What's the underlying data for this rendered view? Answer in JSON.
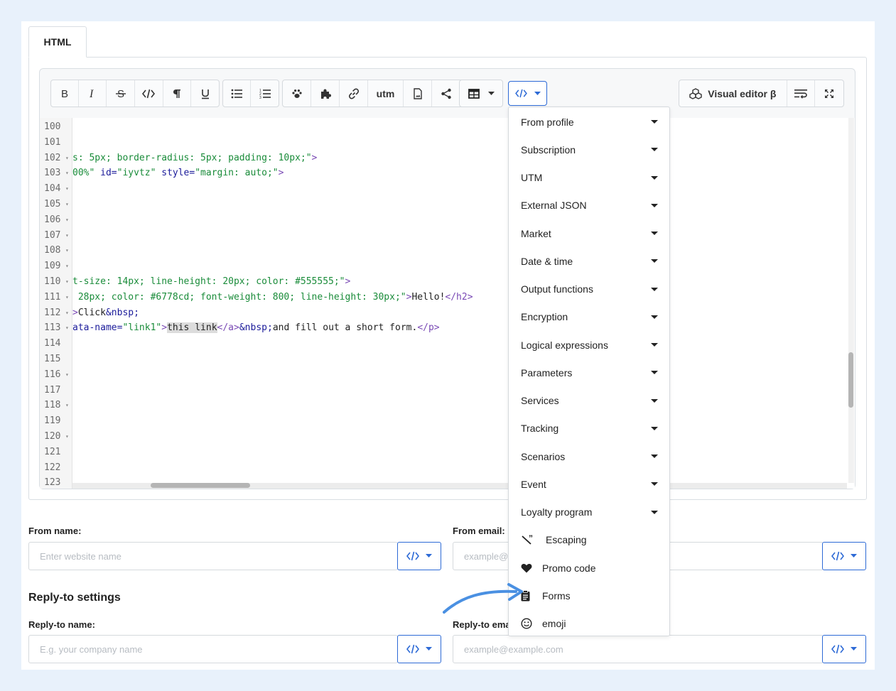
{
  "tabs": [
    {
      "label": "HTML"
    }
  ],
  "toolbar": {
    "utm_label": "utm",
    "visual_editor_label": "Visual editor β"
  },
  "code_lines": [
    {
      "n": "100",
      "fold": false,
      "parts": []
    },
    {
      "n": "101",
      "fold": false,
      "parts": []
    },
    {
      "n": "102",
      "fold": true,
      "parts": [
        [
          "str",
          "s: 5px; border-radius: 5px; padding: 10px;\""
        ],
        [
          "tag",
          ">"
        ]
      ]
    },
    {
      "n": "103",
      "fold": true,
      "parts": [
        [
          "str",
          "00%\""
        ],
        [
          "plain",
          " "
        ],
        [
          "attr",
          "id="
        ],
        [
          "str",
          "\"iyvtz\""
        ],
        [
          "plain",
          " "
        ],
        [
          "attr",
          "style="
        ],
        [
          "str",
          "\"margin: auto;\""
        ],
        [
          "tag",
          ">"
        ]
      ]
    },
    {
      "n": "104",
      "fold": true,
      "parts": []
    },
    {
      "n": "105",
      "fold": true,
      "parts": []
    },
    {
      "n": "106",
      "fold": true,
      "parts": []
    },
    {
      "n": "107",
      "fold": true,
      "parts": []
    },
    {
      "n": "108",
      "fold": true,
      "parts": []
    },
    {
      "n": "109",
      "fold": true,
      "parts": []
    },
    {
      "n": "110",
      "fold": true,
      "parts": [
        [
          "str",
          "t-size: 14px; line-height: 20px; color: #555555;\""
        ],
        [
          "tag",
          ">"
        ]
      ]
    },
    {
      "n": "111",
      "fold": true,
      "parts": [
        [
          "str",
          " 28px; color: #6778cd; font-weight: 800; line-height: 30px;\""
        ],
        [
          "tag",
          ">"
        ],
        [
          "plain",
          "Hello!"
        ],
        [
          "tag",
          "</h2>"
        ]
      ]
    },
    {
      "n": "112",
      "fold": true,
      "parts": [
        [
          "tag",
          ">"
        ],
        [
          "plain",
          "Click"
        ],
        [
          "ent",
          "&nbsp;"
        ]
      ]
    },
    {
      "n": "113",
      "fold": true,
      "parts": [
        [
          "attr",
          "ata-name="
        ],
        [
          "str",
          "\"link1\""
        ],
        [
          "tag",
          ">"
        ],
        [
          "sel",
          "this link"
        ],
        [
          "tag",
          "</a>"
        ],
        [
          "ent",
          "&nbsp;"
        ],
        [
          "plain",
          "and fill out a short form."
        ],
        [
          "tag",
          "</p>"
        ]
      ]
    },
    {
      "n": "114",
      "fold": false,
      "parts": []
    },
    {
      "n": "115",
      "fold": false,
      "parts": []
    },
    {
      "n": "116",
      "fold": true,
      "parts": []
    },
    {
      "n": "117",
      "fold": false,
      "parts": []
    },
    {
      "n": "118",
      "fold": true,
      "parts": []
    },
    {
      "n": "119",
      "fold": false,
      "parts": []
    },
    {
      "n": "120",
      "fold": true,
      "parts": []
    },
    {
      "n": "121",
      "fold": false,
      "parts": []
    },
    {
      "n": "122",
      "fold": false,
      "parts": []
    },
    {
      "n": "123",
      "fold": false,
      "parts": []
    }
  ],
  "dropdown": {
    "submenus": [
      "From profile",
      "Subscription",
      "UTM",
      "External JSON",
      "Market",
      "Date & time",
      "Output functions",
      "Encryption",
      "Logical expressions",
      "Parameters",
      "Services",
      "Tracking",
      "Scenarios",
      "Event",
      "Loyalty program"
    ],
    "actions": [
      {
        "label": "Escaping",
        "icon": "escaping-icon"
      },
      {
        "label": "Promo code",
        "icon": "heart-icon"
      },
      {
        "label": "Forms",
        "icon": "clipboard-icon"
      },
      {
        "label": "emoji",
        "icon": "smiley-icon"
      }
    ]
  },
  "form": {
    "from_name_label": "From name:",
    "from_name_placeholder": "Enter website name",
    "from_email_label": "From email:",
    "from_email_placeholder": "example@",
    "reply_section_title": "Reply-to settings",
    "reply_name_label": "Reply-to name:",
    "reply_name_placeholder": "E.g. your company name",
    "reply_email_label": "Reply-to ema",
    "reply_email_placeholder": "example@example.com"
  },
  "colors": {
    "accent": "#2d6ad6",
    "annotation_arrow": "#4a90e2",
    "page_bg": "#e8f1fb"
  }
}
